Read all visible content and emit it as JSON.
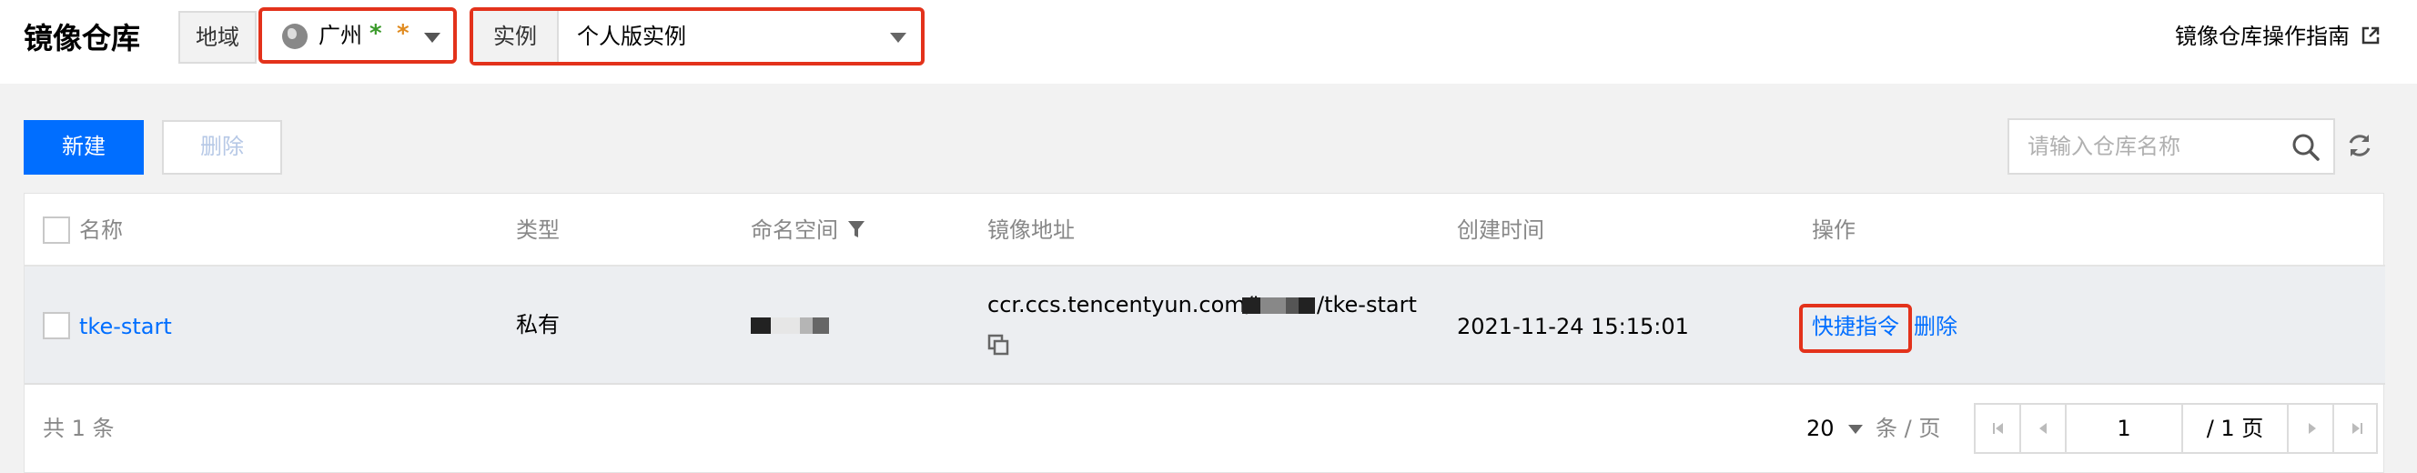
{
  "header": {
    "title": "镜像仓库",
    "region_label": "地域",
    "region_value": "广州",
    "region_masked": "* *",
    "instance_label": "实例",
    "instance_value": "个人版实例",
    "guide_link": "镜像仓库操作指南"
  },
  "toolbar": {
    "new_label": "新建",
    "delete_label": "删除",
    "search_placeholder": "请输入仓库名称"
  },
  "table": {
    "columns": [
      "名称",
      "类型",
      "命名空间",
      "镜像地址",
      "创建时间",
      "操作"
    ],
    "rows": [
      {
        "name": "tke-start",
        "type": "私有",
        "address_prefix": "ccr.ccs.tencentyun.com/'",
        "address_suffix": "/tke-start",
        "created": "2021-11-24 15:15:01",
        "action_quick": "快捷指令",
        "action_delete": "删除"
      }
    ]
  },
  "footer": {
    "total": "共  1  条",
    "page_size": "20",
    "per_page": "条 / 页",
    "current_page": "1",
    "total_pages": "/ 1 页"
  },
  "colors": {
    "primary": "#006eff",
    "highlight_border": "#e3321b"
  }
}
